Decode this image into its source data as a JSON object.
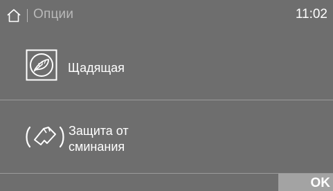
{
  "status_bar": {
    "home_icon": "home-icon",
    "title": "Опции",
    "time": "11:02"
  },
  "options": [
    {
      "icon": "gentle-feather-icon",
      "label": "Щадящая"
    },
    {
      "icon": "anti-crease-icon",
      "label_line1": "Защита от",
      "label_line2": "сминания"
    }
  ],
  "footer": {
    "ok_label": "OK"
  },
  "colors": {
    "background": "#6e6e6e",
    "dim_text": "#b9b9b9",
    "divider": "#9b9b9b",
    "ok_button": "#a3a3a3",
    "text": "#ffffff"
  }
}
